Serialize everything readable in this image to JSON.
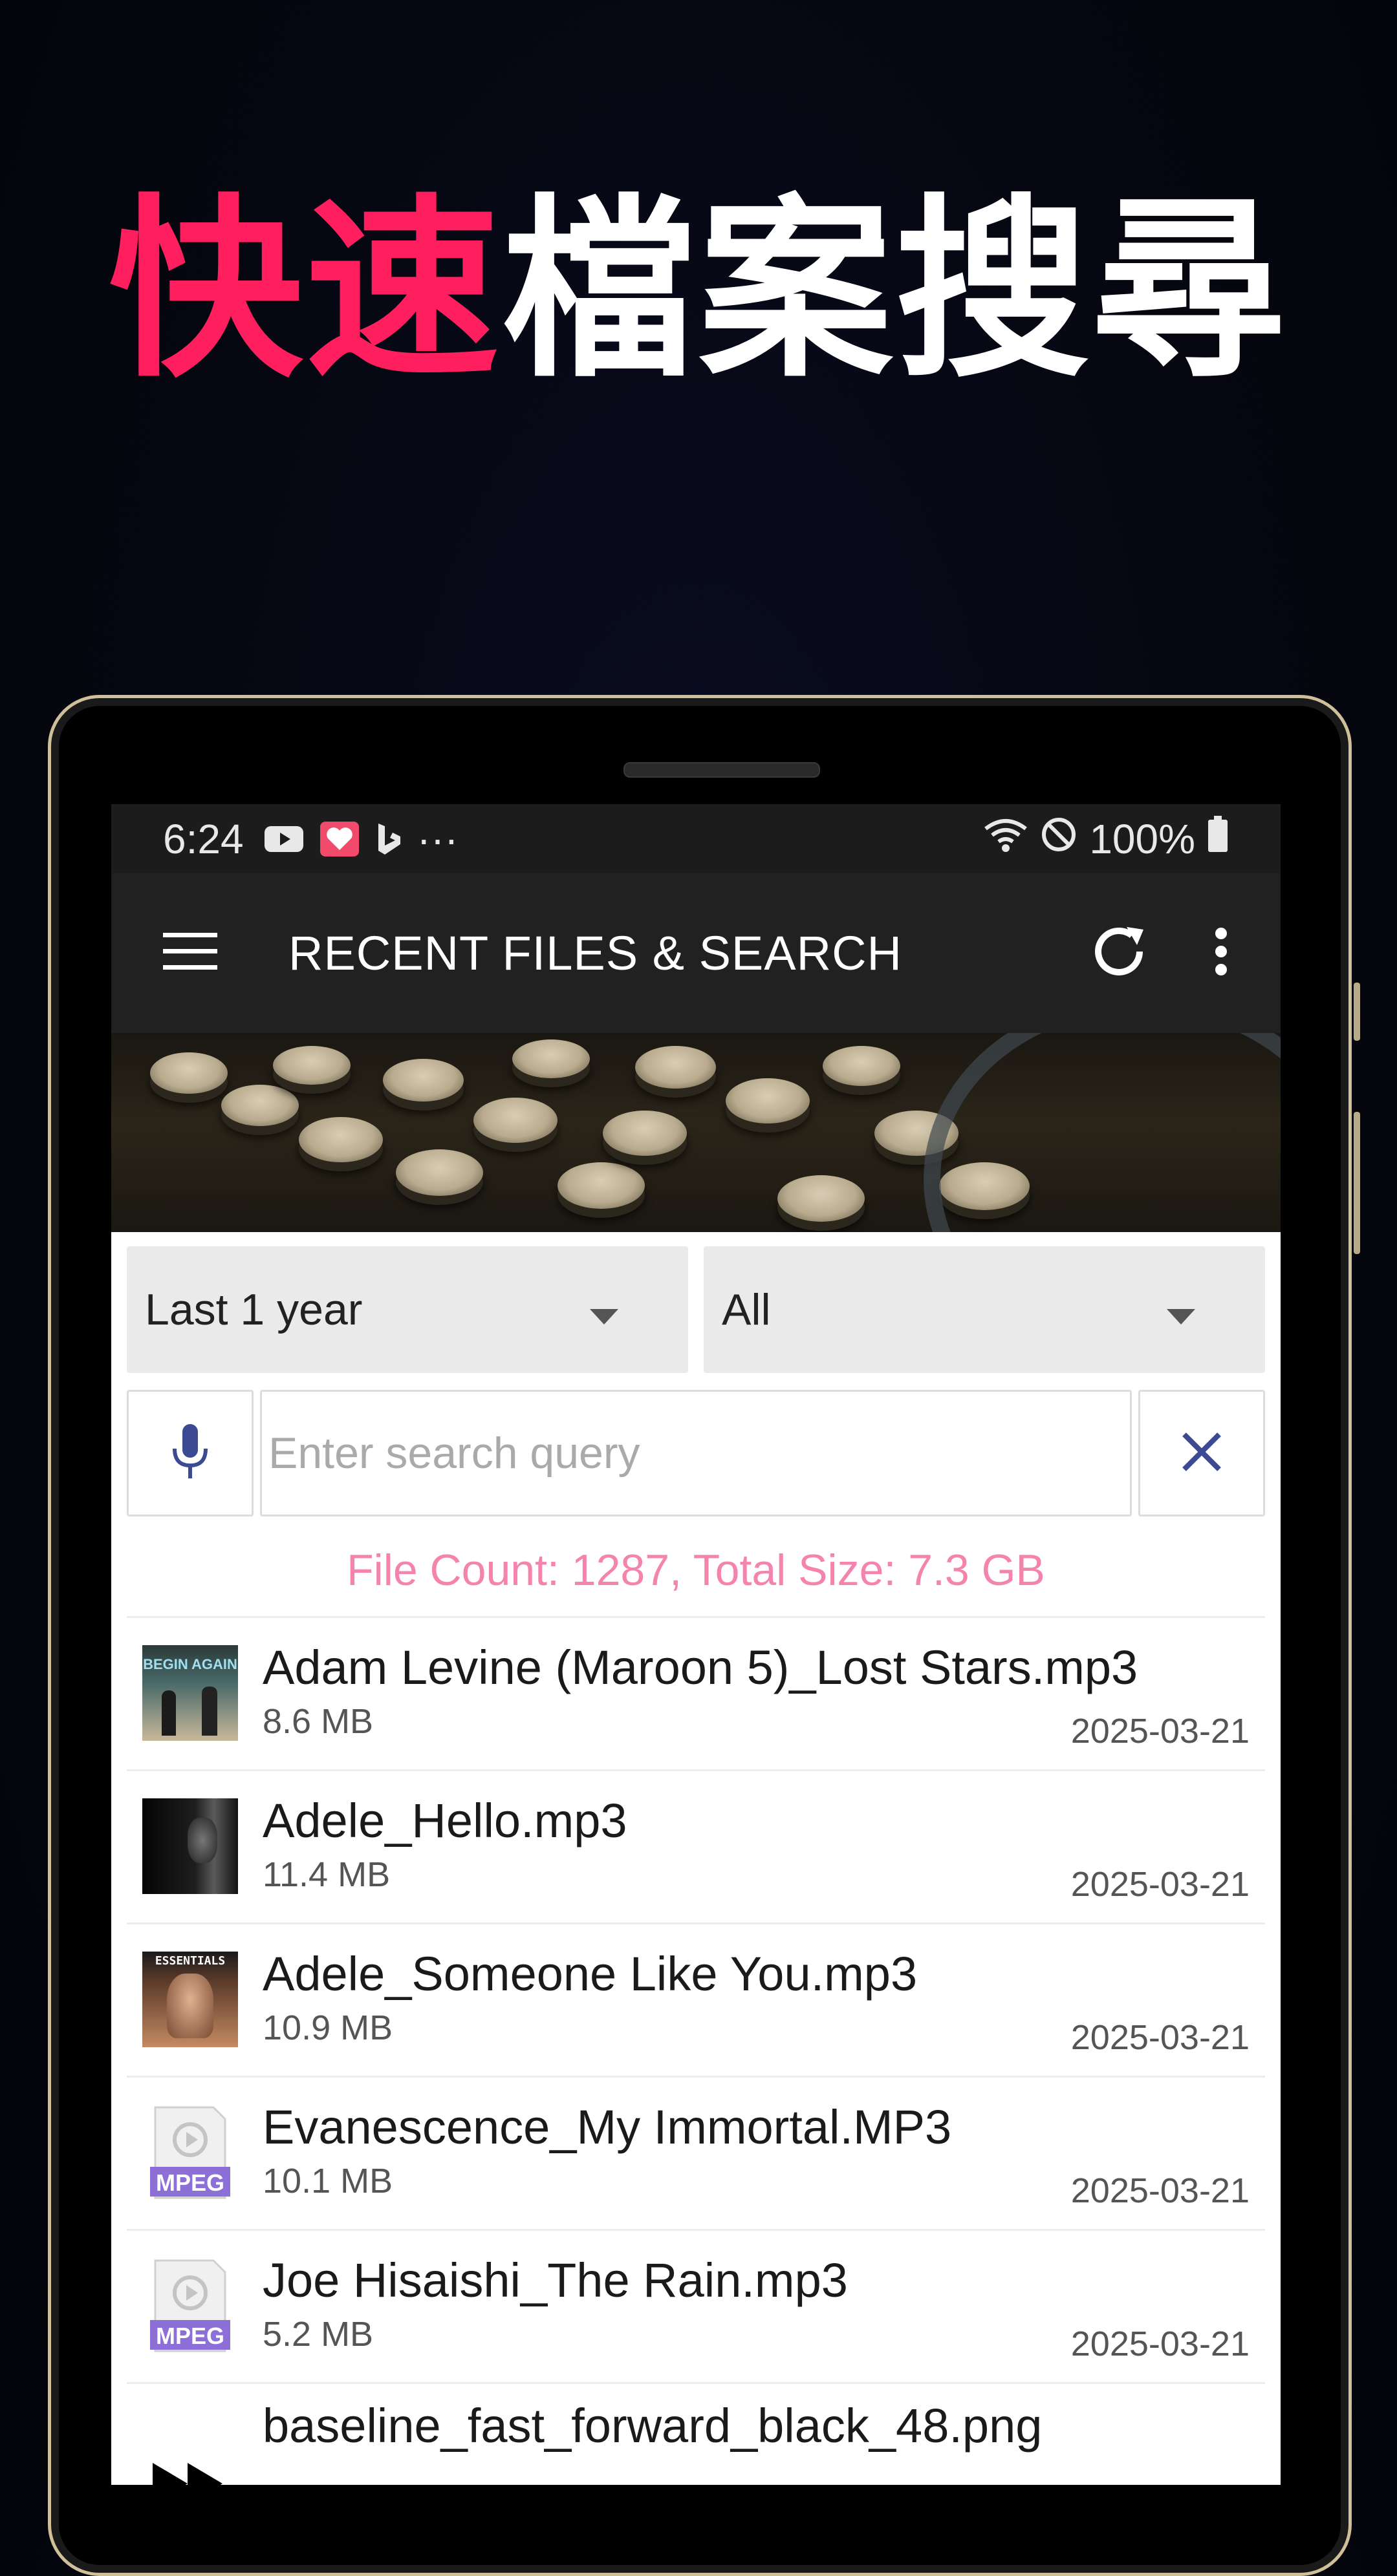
{
  "headline": {
    "accent": "快速",
    "rest": "檔案搜尋",
    "accent_color": "#ff1f5f"
  },
  "status_bar": {
    "time": "6:24",
    "battery": "100%",
    "more": "···"
  },
  "app_bar": {
    "title": "RECENT FILES & SEARCH",
    "menu_icon": "hamburger-icon",
    "refresh_icon": "refresh-icon",
    "more_icon": "overflow-menu-icon"
  },
  "filters": {
    "time_range": "Last 1 year",
    "file_type": "All"
  },
  "search": {
    "placeholder": "Enter search query",
    "mic_icon": "microphone-icon",
    "clear_icon": "close-icon"
  },
  "summary": "File Count: 1287, Total Size: 7.3 GB",
  "files": [
    {
      "name": "Adam Levine (Maroon 5)_Lost Stars.mp3",
      "size": "8.6 MB",
      "date": "2025-03-21",
      "thumb": "album-art",
      "thumb_text": "BEGIN AGAIN"
    },
    {
      "name": "Adele_Hello.mp3",
      "size": "11.4 MB",
      "date": "2025-03-21",
      "thumb": "album-art-dark"
    },
    {
      "name": "Adele_Someone Like You.mp3",
      "size": "10.9 MB",
      "date": "2025-03-21",
      "thumb": "album-art-portrait",
      "thumb_text": "ESSENTIALS"
    },
    {
      "name": "Evanescence_My Immortal.MP3",
      "size": "10.1 MB",
      "date": "2025-03-21",
      "thumb": "mpeg-file-icon",
      "thumb_text": "MPEG"
    },
    {
      "name": "Joe Hisaishi_The Rain.mp3",
      "size": "5.2 MB",
      "date": "2025-03-21",
      "thumb": "mpeg-file-icon",
      "thumb_text": "MPEG"
    },
    {
      "name": "baseline_fast_forward_black_48.png",
      "size": "",
      "date": "",
      "thumb": "fast-forward-icon"
    }
  ]
}
